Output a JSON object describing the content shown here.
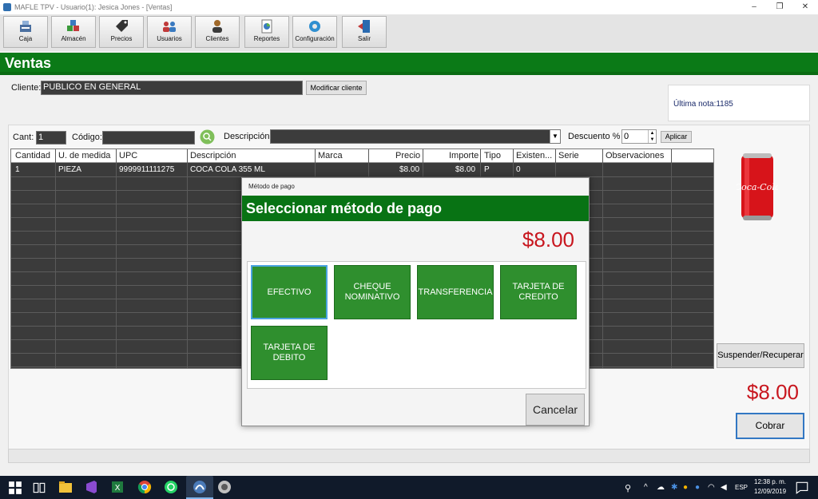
{
  "window": {
    "title": "MAFLE TPV - Usuario(1): Jesica Jones - [Ventas]",
    "controls": [
      "–",
      "❐",
      "✕"
    ]
  },
  "toolbar": [
    {
      "label": "Caja",
      "icon": "cash-register-icon",
      "color": "#5a7fb0"
    },
    {
      "label": "Almacén",
      "icon": "warehouse-icon",
      "color": "#3a9a3a"
    },
    {
      "label": "Precios",
      "icon": "price-tag-icon",
      "color": "#333333"
    },
    {
      "label": "Usuarios",
      "icon": "users-icon",
      "color": "#c03a3a"
    },
    {
      "label": "Clientes",
      "icon": "client-icon",
      "color": "#a0692a"
    },
    {
      "label": "Reportes",
      "icon": "reports-icon",
      "color": "#3a7ac0"
    },
    {
      "label": "Configuración",
      "icon": "gear-icon",
      "color": "#2f8fd0"
    },
    {
      "label": "Salir",
      "icon": "exit-door-icon",
      "color": "#2a6ab0"
    }
  ],
  "header": {
    "title": "Ventas"
  },
  "client": {
    "label": "Cliente:",
    "value": "PUBLICO EN GENERAL",
    "modify_button": "Modificar cliente"
  },
  "last_note": "Última nota:1185",
  "entry": {
    "cant_label": "Cant:",
    "cant_value": "1",
    "codigo_label": "Código:",
    "codigo_value": "",
    "descripcion_label": "Descripción",
    "descripcion_value": "",
    "descuento_label": "Descuento %",
    "descuento_value": "0",
    "aplicar_button": "Aplicar"
  },
  "grid": {
    "columns": [
      "Cantidad",
      "U. de medida",
      "UPC",
      "Descripción",
      "Marca",
      "Precio",
      "Importe",
      "Tipo",
      "Existen...",
      "Serie",
      "Observaciones"
    ],
    "rows": [
      [
        "1",
        "PIEZA",
        "9999911111275",
        "COCA COLA 355 ML",
        "",
        "$8.00",
        "$8.00",
        "P",
        "0",
        "",
        ""
      ]
    ]
  },
  "side": {
    "suspend_button": "Suspender/Recuperar",
    "total": "$8.00",
    "cobrar_button": "Cobrar",
    "product_image_text": "Coca-Cola"
  },
  "dialog": {
    "window_title": "Método de pago",
    "heading": "Seleccionar método de pago",
    "amount": "$8.00",
    "methods": [
      "EFECTIVO",
      "CHEQUE NOMINATIVO",
      "TRANSFERENCIA",
      "TARJETA DE CREDITO",
      "TARJETA DE DEBITO"
    ],
    "cancel_button": "Cancelar"
  },
  "taskbar": {
    "language": "ESP",
    "time": "12:38 p. m.",
    "date": "12/09/2019",
    "apps": [
      "start-icon",
      "task-view-icon",
      "file-explorer-icon",
      "visual-studio-icon",
      "excel-icon",
      "chrome-icon",
      "whatsapp-icon",
      "mafle-tpv-icon",
      "app-icon"
    ]
  },
  "colors": {
    "brand_green": "#0b7a17",
    "pay_green": "#2f8f2e",
    "total_red": "#c8161e",
    "accent_blue": "#3277c3"
  }
}
